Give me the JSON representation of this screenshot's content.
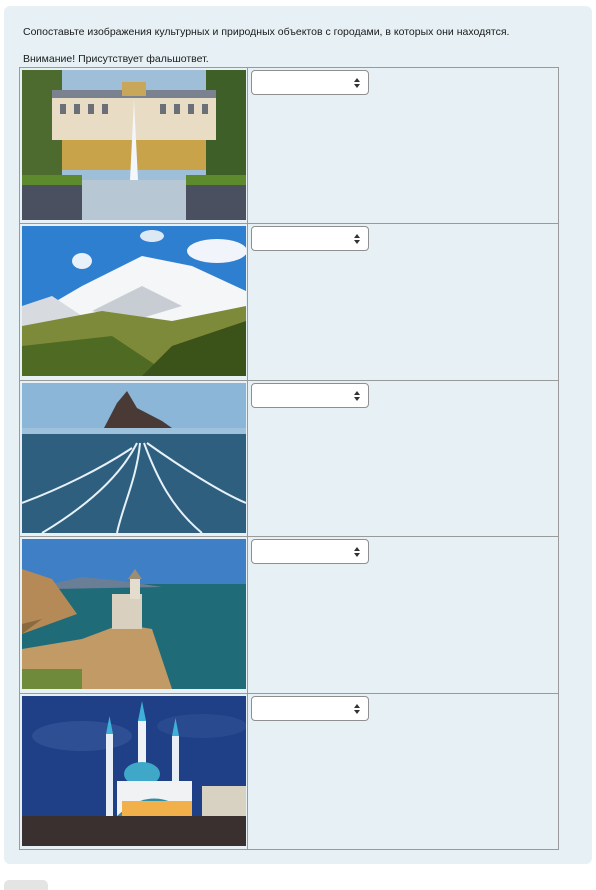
{
  "question": {
    "prompt": "Сопоставьте изображения культурных и природных объектов с городами, в которых они находятся.",
    "warning": "Внимание! Присутствует фальшответ."
  },
  "rows": [
    {
      "image": "peterhof-palace-fountain",
      "selected": ""
    },
    {
      "image": "snowy-mountain-valley",
      "selected": ""
    },
    {
      "image": "frozen-lake-rock",
      "selected": ""
    },
    {
      "image": "swallows-nest-castle",
      "selected": ""
    },
    {
      "image": "kul-sharif-mosque-night",
      "selected": ""
    }
  ],
  "colors": {
    "card_bg": "#e7f1f5",
    "border": "#9a9a9a"
  }
}
